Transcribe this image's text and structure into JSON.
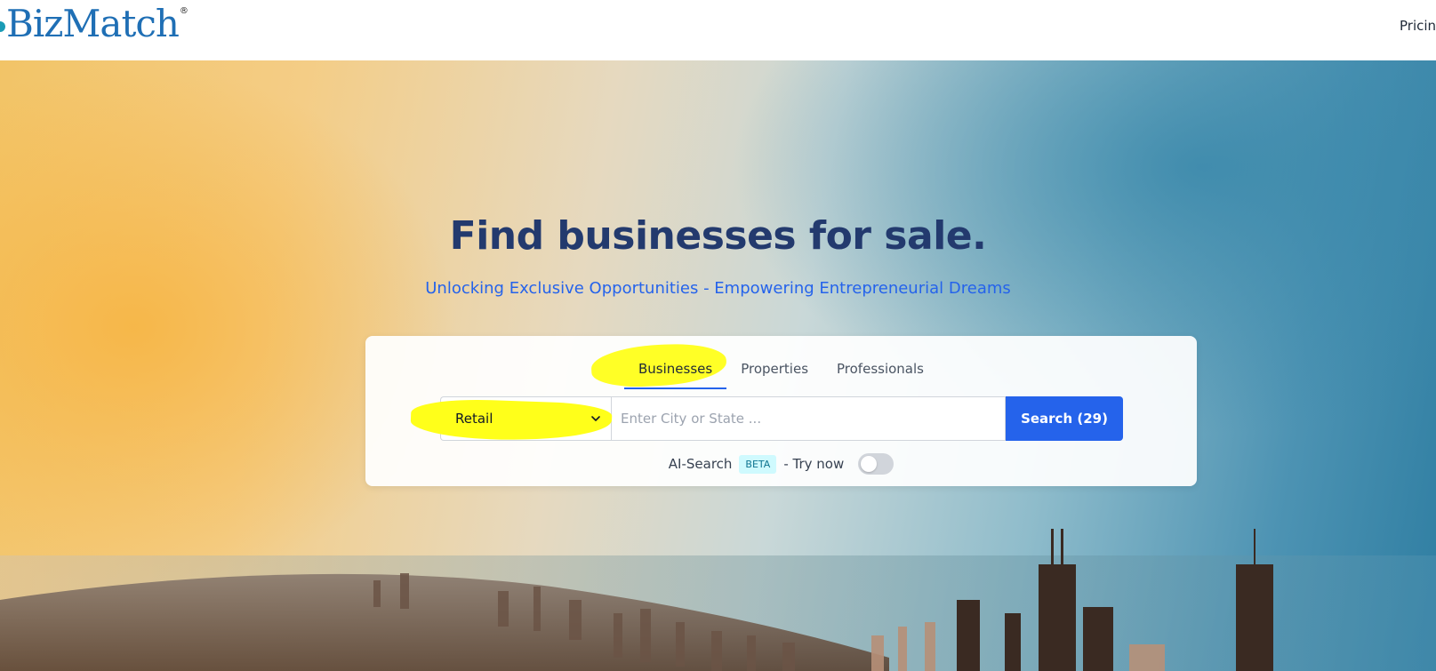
{
  "header": {
    "logo_text": "BizMatch",
    "logo_mark": "®",
    "nav_item": "Pricin"
  },
  "hero": {
    "title": "Find businesses for sale.",
    "subtitle": "Unlocking Exclusive Opportunities - Empowering Entrepreneurial Dreams"
  },
  "search": {
    "tabs": [
      {
        "label": "Businesses",
        "active": true
      },
      {
        "label": "Properties",
        "active": false
      },
      {
        "label": "Professionals",
        "active": false
      }
    ],
    "category": {
      "selected": "Retail"
    },
    "location": {
      "placeholder": "Enter City or State ...",
      "value": ""
    },
    "button_label": "Search (29)",
    "ai": {
      "label": "AI-Search",
      "badge": "BETA",
      "try_text": "- Try now",
      "enabled": false
    }
  },
  "colors": {
    "brand_blue": "#1f6fb5",
    "title_navy": "#233a6e",
    "accent_blue": "#2563eb",
    "highlight_yellow": "#ffff1a"
  }
}
